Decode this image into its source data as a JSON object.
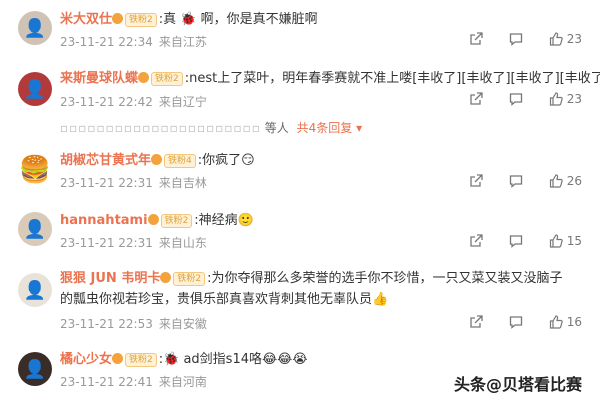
{
  "comments": [
    {
      "user": "米大双仕",
      "badge": "铁粉2",
      "text": ":真 🐞 啊，你是真不嫌脏啊",
      "time": "23-11-21 22:34",
      "location": "来自江苏",
      "likes": "23"
    },
    {
      "user": "来斯曼球队蝶",
      "badge": "铁粉2",
      "text": ":nest上了菜叶，明年春季赛就不准上喽[丰收了][丰收了][丰收了][丰收了]",
      "time": "23-11-21 22:42",
      "location": "来自辽宁",
      "likes": "23"
    },
    {
      "user": "胡椒芯甘黄式年",
      "badge": "铁粉4",
      "text": ":你疯了😏",
      "time": "23-11-21 22:31",
      "location": "来自吉林",
      "likes": "26"
    },
    {
      "user": "hannahtami",
      "badge": "铁粉2",
      "text": ":神经病🙂",
      "time": "23-11-21 22:31",
      "location": "来自山东",
      "likes": "15"
    },
    {
      "user": "狠狠 JUN 韦明卡",
      "badge": "铁粉2",
      "text": ":为你夺得那么多荣誉的选手你不珍惜，一只又菜又装又没脑子的瓢虫你视若珍宝，贵俱乐部真喜欢背刺其他无辜队员👍",
      "time": "23-11-21 22:53",
      "location": "来自安徽",
      "likes": "16"
    },
    {
      "user": "橘心少女",
      "badge": "铁粉2",
      "text": ":🐞 ad剑指s14咯😂😂😭",
      "time": "23-11-21 22:41",
      "location": "来自河南",
      "likes": ""
    }
  ],
  "replies": {
    "names": "等人",
    "link": "共4条回复"
  },
  "watermark": "头条@贝塔看比赛"
}
